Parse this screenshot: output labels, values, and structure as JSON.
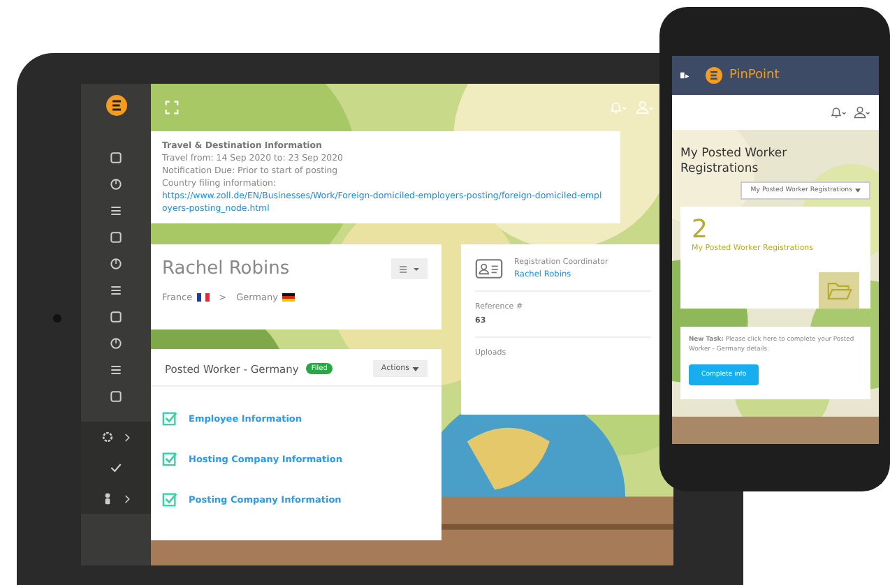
{
  "tablet": {
    "travel_card": {
      "title": "Travel & Destination Information",
      "lines": [
        "Travel from: 14 Sep 2020 to: 23 Sep 2020",
        "Notification Due: Prior to start of posting"
      ],
      "filing_label": "Country filing information:",
      "filing_link": "https://www.zoll.de/EN/Businesses/Work/Foreign-domiciled-employers-posting/foreign-domiciled-employers-posting_node.html"
    },
    "profile_card": {
      "name": "Rachel Robins",
      "origin": "France",
      "separator": ">",
      "destination": "Germany"
    },
    "coordinator_card": {
      "role": "Registration Coordinator",
      "name": "Rachel Robins",
      "reference_label": "Reference #",
      "reference_value": "63",
      "uploads_label": "Uploads"
    },
    "registration_card": {
      "title": "Posted Worker - Germany",
      "status": "Filed",
      "actions_button": "Actions",
      "items": [
        {
          "label": "Employee Information",
          "checked": true
        },
        {
          "label": "Hosting Company Information",
          "checked": true
        },
        {
          "label": "Posting Company Information",
          "checked": true
        }
      ]
    }
  },
  "phone": {
    "app_name": "PinPoint",
    "page_title": "My Posted Worker Registrations",
    "filter_dropdown": "My Posted Worker Registrations",
    "stat": {
      "count": "2",
      "label": "My Posted Worker Registrations"
    },
    "task": {
      "text": "**New Task:** Please click here to complete your Posted Worker - Germany details.",
      "button": "Complete info"
    }
  }
}
